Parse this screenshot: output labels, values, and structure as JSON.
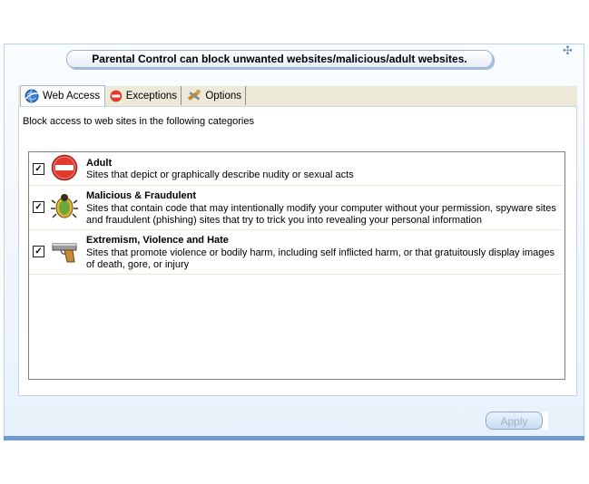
{
  "banner": {
    "text": "Parental Control can block unwanted websites/malicious/adult websites."
  },
  "tabs": [
    {
      "label": "Web Access",
      "icon": "globe-icon",
      "active": true
    },
    {
      "label": "Exceptions",
      "icon": "no-entry-icon",
      "active": false
    },
    {
      "label": "Options",
      "icon": "tools-icon",
      "active": false
    }
  ],
  "panel": {
    "description": "Block access to web sites in the following categories"
  },
  "categories": [
    {
      "title": "Adult",
      "description": "Sites that depict or graphically describe nudity or sexual acts",
      "checked": true,
      "icon": "stop-sign-icon"
    },
    {
      "title": "Malicious & Fraudulent",
      "description": "Sites that contain code that may intentionally modify your computer without your permission, spyware sites and fraudulent (phishing) sites that try to trick you into revealing your personal information",
      "checked": true,
      "icon": "bug-icon"
    },
    {
      "title": "Extremism, Violence and Hate",
      "description": "Sites that promote violence or bodily harm, including self inflicted harm, or that gratuitously display images of death, gore, or injury",
      "checked": true,
      "icon": "gun-icon"
    }
  ],
  "apply": {
    "label": "Apply",
    "enabled": false
  },
  "colors": {
    "accent": "#6f99cf",
    "stop_red": "#e23a2e",
    "tab_bg": "#ece9d8"
  }
}
